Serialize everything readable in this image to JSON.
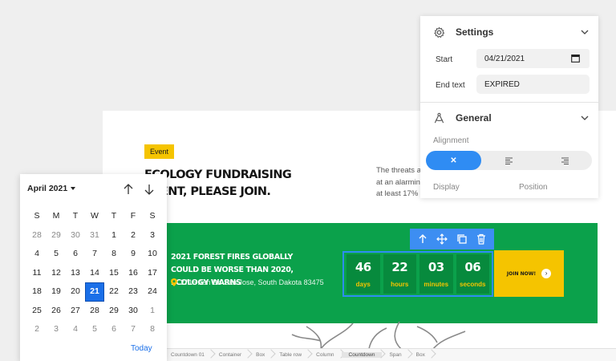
{
  "canvas": {
    "badge": "Event",
    "title": "ECOLOGY FUNDRAISING EVENT, PLEASE JOIN.",
    "description": "The threats ar at an alarming at least 17% o"
  },
  "banner": {
    "news_title": "2021 FOREST FIRES GLOBALLY COULD BE WORSE THAN 2020, ECOLOGY WARNS",
    "address": "2715 Ash Dr. San Jose, South Dakota 83475",
    "countdown": [
      {
        "value": "46",
        "label": "days"
      },
      {
        "value": "22",
        "label": "hours"
      },
      {
        "value": "03",
        "label": "minutes"
      },
      {
        "value": "06",
        "label": "seconds"
      }
    ],
    "join_label": "JOIN NOW!"
  },
  "breadcrumb": [
    "Countdown 01",
    "Container",
    "Box",
    "Table row",
    "Column",
    "Countdown",
    "Span",
    "Box"
  ],
  "settings": {
    "title": "Settings",
    "start_label": "Start",
    "start_value": "04/21/2021",
    "end_label": "End text",
    "end_value": "EXPIRED",
    "general_title": "General",
    "alignment_label": "Alignment",
    "alignment_options": [
      "✕",
      "≡",
      "≡"
    ],
    "display_label": "Display",
    "position_label": "Position"
  },
  "datepicker": {
    "month_label": "April 2021",
    "weekday_headers": [
      "S",
      "M",
      "T",
      "W",
      "T",
      "F",
      "S"
    ],
    "days": [
      "28",
      "29",
      "30",
      "31",
      "1",
      "2",
      "3",
      "4",
      "5",
      "6",
      "7",
      "8",
      "9",
      "10",
      "11",
      "12",
      "13",
      "14",
      "15",
      "16",
      "17",
      "18",
      "19",
      "20",
      "21",
      "22",
      "23",
      "24",
      "25",
      "26",
      "27",
      "28",
      "29",
      "30",
      "1",
      "2",
      "3",
      "4",
      "5",
      "6",
      "7",
      "8"
    ],
    "selected_day": "21",
    "today_label": "Today"
  },
  "colors": {
    "accent_blue": "#2f8cf3",
    "banner_green": "#0ba14b",
    "badge_yellow": "#f5c400"
  }
}
